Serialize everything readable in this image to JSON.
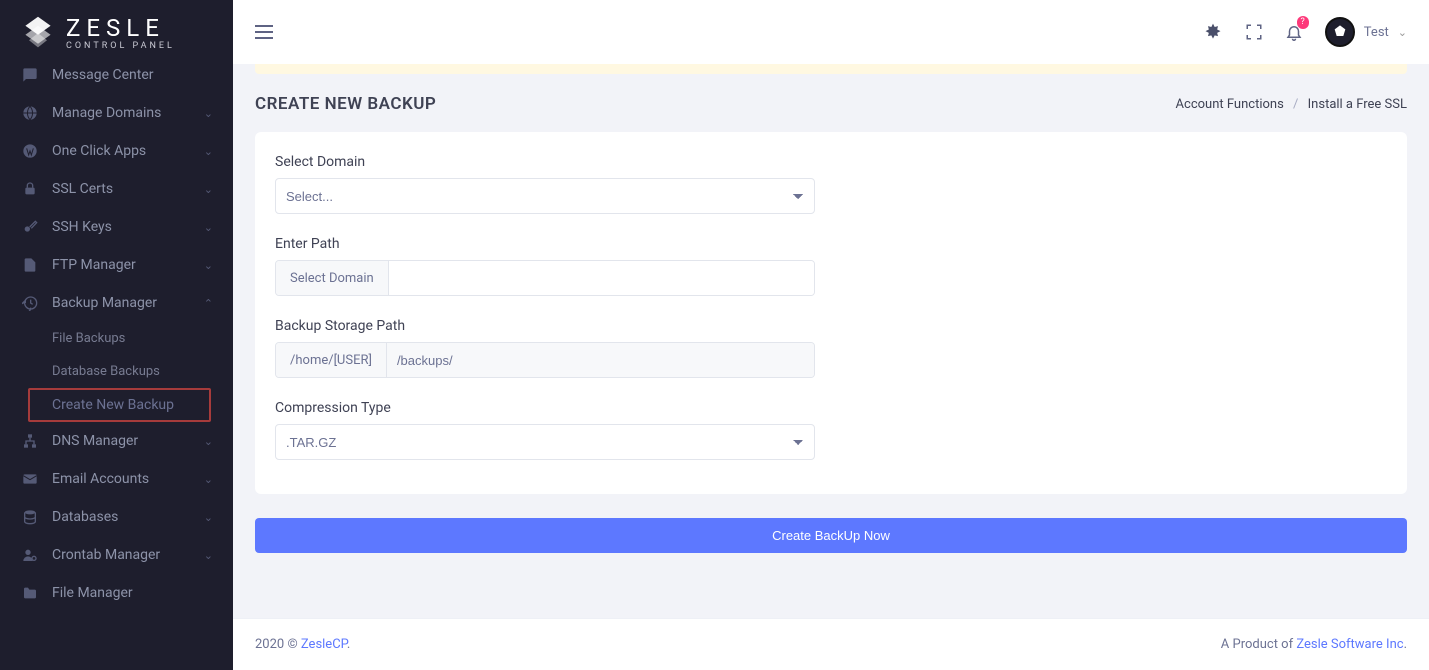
{
  "brand": {
    "name": "ZESLE",
    "tagline": "CONTROL PANEL"
  },
  "sidebar": {
    "items": [
      {
        "label": "Message Center",
        "icon": "chat",
        "expand": false
      },
      {
        "label": "Manage Domains",
        "icon": "globe",
        "expand": true
      },
      {
        "label": "One Click Apps",
        "icon": "wordpress",
        "expand": true
      },
      {
        "label": "SSL Certs",
        "icon": "lock",
        "expand": true
      },
      {
        "label": "SSH Keys",
        "icon": "key",
        "expand": true
      },
      {
        "label": "FTP Manager",
        "icon": "file",
        "expand": true
      },
      {
        "label": "Backup Manager",
        "icon": "history",
        "expand": true,
        "open": true
      },
      {
        "label": "DNS Manager",
        "icon": "sitemap",
        "expand": true
      },
      {
        "label": "Email Accounts",
        "icon": "mail",
        "expand": true
      },
      {
        "label": "Databases",
        "icon": "database",
        "expand": true
      },
      {
        "label": "Crontab Manager",
        "icon": "users-cog",
        "expand": true
      },
      {
        "label": "File Manager",
        "icon": "folder",
        "expand": false
      }
    ],
    "backup_children": [
      {
        "label": "File Backups"
      },
      {
        "label": "Database Backups"
      },
      {
        "label": "Create New Backup",
        "active": true
      }
    ]
  },
  "topbar": {
    "notification_badge": "?",
    "user": "Test"
  },
  "page": {
    "title": "CREATE NEW BACKUP",
    "breadcrumb": [
      "Account Functions",
      "Install a Free SSL"
    ]
  },
  "form": {
    "select_domain_label": "Select Domain",
    "select_domain_placeholder": "Select...",
    "enter_path_label": "Enter Path",
    "enter_path_addon": "Select Domain",
    "enter_path_value": "",
    "storage_label": "Backup Storage Path",
    "storage_prefix": "/home/[USER]",
    "storage_value": "/backups/",
    "compression_label": "Compression Type",
    "compression_value": ".TAR.GZ",
    "submit": "Create BackUp Now"
  },
  "footer": {
    "copyright_prefix": "2020 © ",
    "copyright_link": "ZesleCP",
    "right_prefix": "A Product of ",
    "right_link": "Zesle Software Inc"
  }
}
